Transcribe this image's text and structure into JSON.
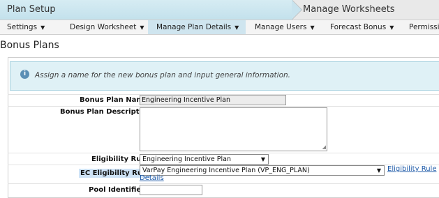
{
  "breadcrumbs": {
    "step1": "Plan Setup",
    "step2": "Manage Worksheets"
  },
  "menu": {
    "items": [
      {
        "label": "Settings"
      },
      {
        "label": "Design Worksheet"
      },
      {
        "label": "Manage Plan Details"
      },
      {
        "label": "Manage Users"
      },
      {
        "label": "Forecast Bonus"
      },
      {
        "label": "Permissio"
      }
    ],
    "active": "Manage Plan Details"
  },
  "page": {
    "title": "Bonus Plans"
  },
  "info": {
    "message": "Assign a name for the new bonus plan and input general information."
  },
  "form": {
    "name_label": "Bonus Plan Name:",
    "name_value": "Engineering Incentive Plan",
    "desc_label": "Bonus Plan Description:",
    "eligibility_label": "Eligibility Rule",
    "eligibility_value": "Engineering Incentive Plan",
    "ec_label": "EC Eligibility Rule",
    "ec_value": "VarPay Engineering Incentive Plan (VP_ENG_PLAN)",
    "ec_link": "Eligibility Rule",
    "details_link": "Details",
    "pool_label": "Pool Identifier:"
  }
}
